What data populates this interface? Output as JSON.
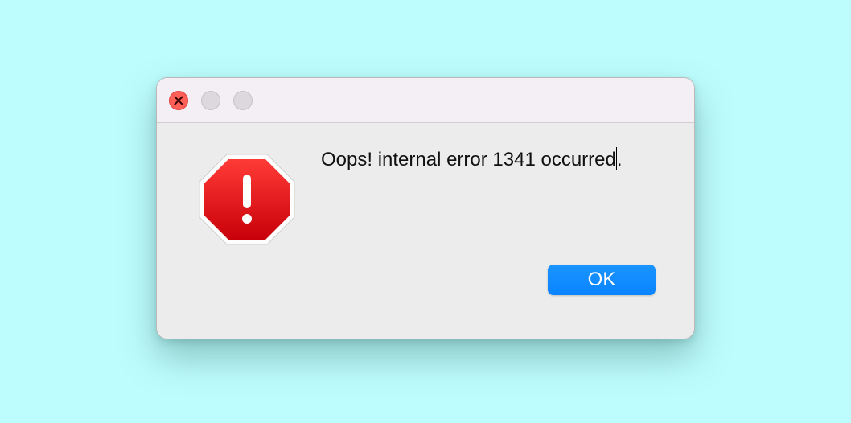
{
  "window": {
    "controls": {
      "close_icon": "close-icon",
      "minimize": "minimize-button",
      "maximize": "maximize-button"
    }
  },
  "dialog": {
    "icon": "stop-sign-warning-icon",
    "message": "Oops! internal error 1341 occurred",
    "message_suffix": ".",
    "ok_label": "OK"
  },
  "colors": {
    "background": "#bdfdfd",
    "accent": "#0a84ff",
    "close": "#fe5f57",
    "stop_red": "#e3131b"
  }
}
